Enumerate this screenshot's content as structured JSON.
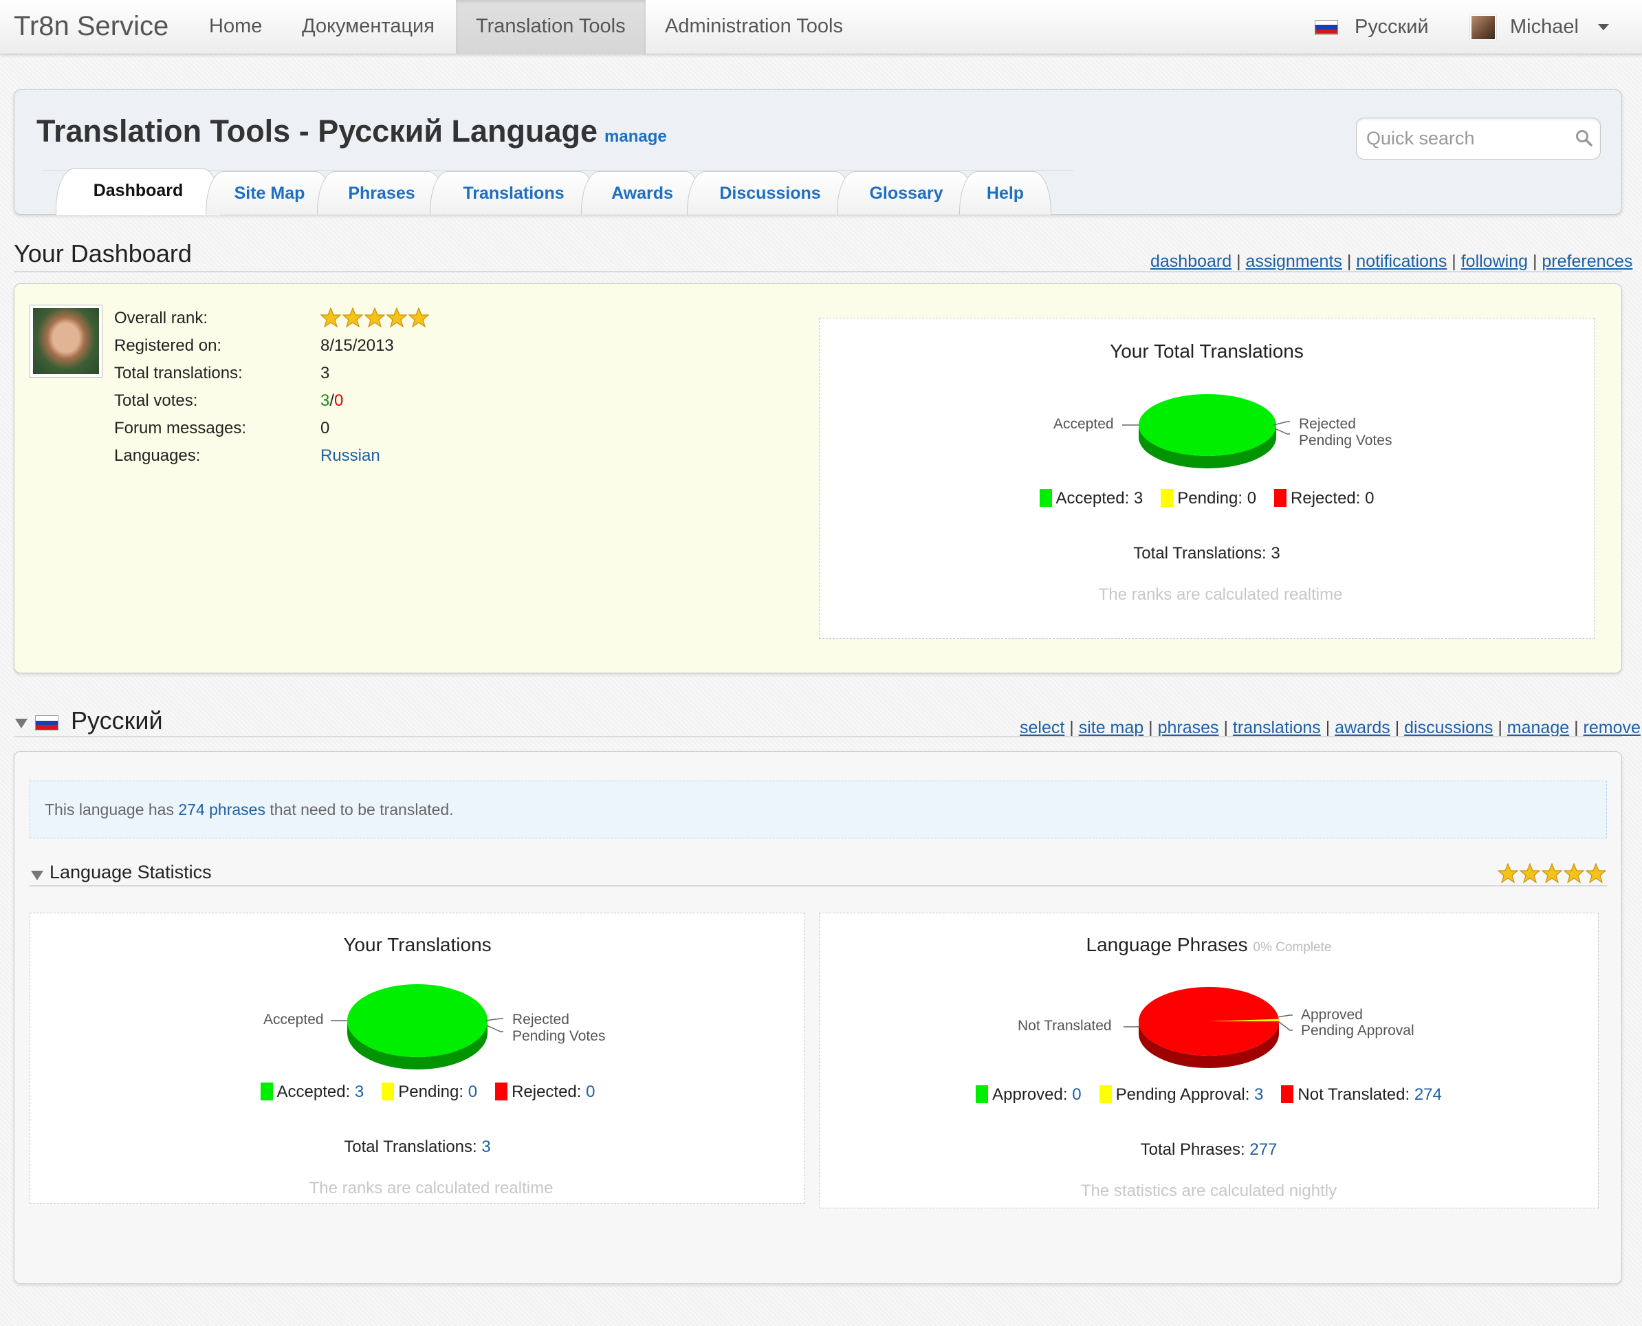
{
  "topnav": {
    "brand": "Tr8n Service",
    "items": [
      "Home",
      "Документация",
      "Translation Tools",
      "Administration Tools"
    ],
    "language": "Русский",
    "user": "Michael"
  },
  "header": {
    "title": "Translation Tools - Русский Language",
    "manage": "manage",
    "search_placeholder": "Quick search",
    "tabs": [
      "Dashboard",
      "Site Map",
      "Phrases",
      "Translations",
      "Awards",
      "Discussions",
      "Glossary",
      "Help"
    ]
  },
  "dashboard": {
    "title": "Your Dashboard",
    "links": [
      "dashboard",
      "assignments",
      "notifications",
      "following",
      "preferences"
    ],
    "profile": {
      "overall_rank_label": "Overall rank:",
      "overall_rank_stars": 5,
      "registered_label": "Registered on:",
      "registered_value": "8/15/2013",
      "total_translations_label": "Total translations:",
      "total_translations_value": "3",
      "total_votes_label": "Total votes:",
      "votes_up": "3",
      "votes_sep": "/",
      "votes_down": "0",
      "forum_label": "Forum messages:",
      "forum_value": "0",
      "languages_label": "Languages:",
      "languages_value": "Russian"
    },
    "total_chart": {
      "title": "Your Total Translations",
      "labels": {
        "accepted": "Accepted",
        "rejected": "Rejected",
        "pending": "Pending Votes"
      },
      "legend": [
        {
          "text": "Accepted: 3",
          "color": "#00ee00"
        },
        {
          "text": "Pending: 0",
          "color": "#ffff00"
        },
        {
          "text": "Rejected: 0",
          "color": "#ff0000"
        }
      ],
      "total": "Total Translations: 3",
      "note": "The ranks are calculated realtime"
    }
  },
  "language": {
    "name": "Русский",
    "links": [
      "select",
      "site map",
      "phrases",
      "translations",
      "awards",
      "discussions",
      "manage",
      "remove"
    ],
    "notice_pre": "This language has",
    "notice_link": "274 phrases",
    "notice_post": "that need to be translated.",
    "stats_title": "Language Statistics",
    "stats_stars": 5,
    "your_chart": {
      "title": "Your Translations",
      "labels": {
        "accepted": "Accepted",
        "rejected": "Rejected",
        "pending": "Pending Votes"
      },
      "legend": [
        {
          "label": "Accepted:",
          "value": "3",
          "color": "#00ee00"
        },
        {
          "label": "Pending:",
          "value": "0",
          "color": "#ffff00"
        },
        {
          "label": "Rejected:",
          "value": "0",
          "color": "#ff0000"
        }
      ],
      "total_label": "Total Translations:",
      "total_value": "3",
      "note": "The ranks are calculated realtime"
    },
    "phrases_chart": {
      "title": "Language Phrases",
      "subtitle": "0% Complete",
      "labels": {
        "not_translated": "Not Translated",
        "approved": "Approved",
        "pending": "Pending Approval"
      },
      "legend": [
        {
          "label": "Approved:",
          "value": "0",
          "color": "#00ee00"
        },
        {
          "label": "Pending Approval:",
          "value": "3",
          "color": "#ffff00"
        },
        {
          "label": "Not Translated:",
          "value": "274",
          "color": "#ff0000"
        }
      ],
      "total_label": "Total Phrases:",
      "total_value": "277",
      "note": "The statistics are calculated nightly"
    }
  },
  "chart_data": [
    {
      "type": "pie",
      "title": "Your Total Translations",
      "categories": [
        "Accepted",
        "Pending",
        "Rejected"
      ],
      "values": [
        3,
        0,
        0
      ],
      "colors": [
        "#00ee00",
        "#ffff00",
        "#ff0000"
      ]
    },
    {
      "type": "pie",
      "title": "Your Translations",
      "categories": [
        "Accepted",
        "Pending",
        "Rejected"
      ],
      "values": [
        3,
        0,
        0
      ],
      "colors": [
        "#00ee00",
        "#ffff00",
        "#ff0000"
      ]
    },
    {
      "type": "pie",
      "title": "Language Phrases",
      "categories": [
        "Approved",
        "Pending Approval",
        "Not Translated"
      ],
      "values": [
        0,
        3,
        274
      ],
      "colors": [
        "#00ee00",
        "#ffff00",
        "#ff0000"
      ]
    }
  ]
}
